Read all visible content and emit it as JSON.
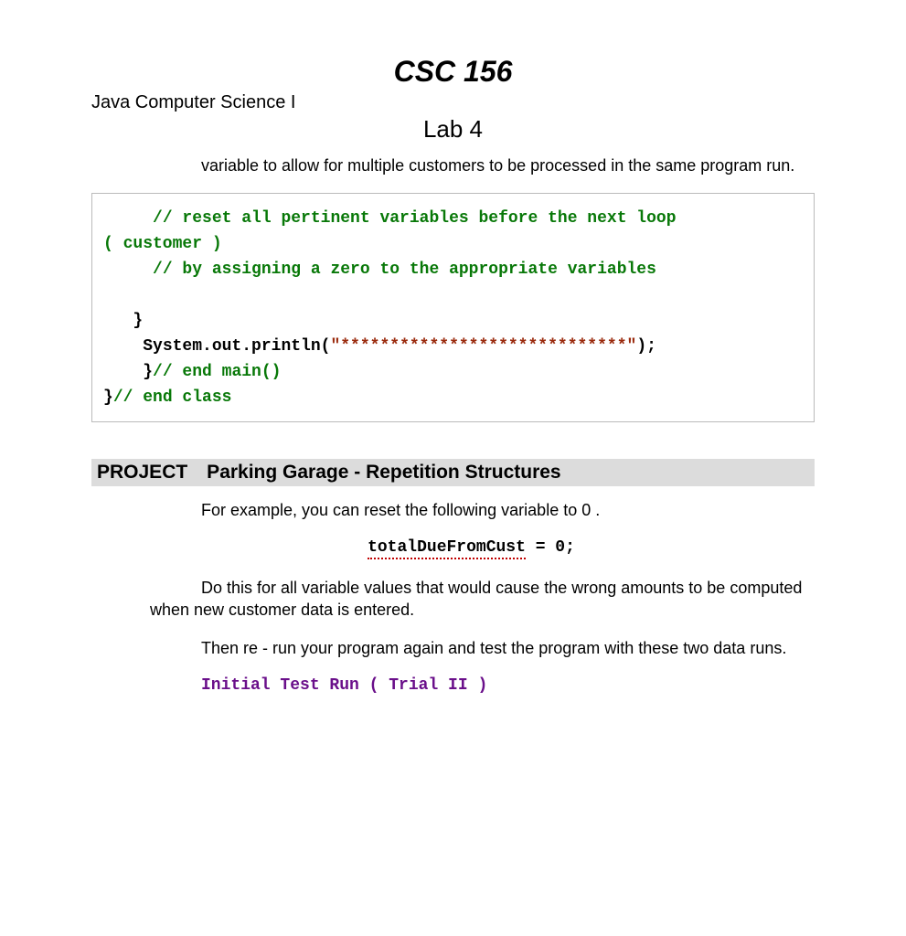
{
  "header": {
    "course_code": "CSC 156",
    "course_name": "Java Computer Science I",
    "lab_title": "Lab 4"
  },
  "body": {
    "para1": "variable to allow for multiple customers to be processed in the same program run.",
    "code": {
      "line1_indent": "     ",
      "line1_comment": "// reset all pertinent variables before the next loop",
      "line2": "( customer )",
      "line3_indent": "     ",
      "line3_comment": "// by assigning a zero to the appropriate variables",
      "line_blank": "",
      "line4": "   }",
      "line5_indent": "    ",
      "line5_call_a": "System.out.println(",
      "line5_str": "\"*****************************\"",
      "line5_call_b": ");",
      "line6_indent": "    ",
      "line6_brace": "}",
      "line6_comment": "// end main()",
      "line7_brace": "}",
      "line7_comment": "// end class"
    },
    "section_header": "PROJECT Parking Garage - Repetition Structures",
    "para2": "For example, you can reset the following variable to 0 .",
    "inline_code_underlined": "totalDueFromCust",
    "inline_code_rest": " = 0;",
    "para3": "Do this for all variable values that would cause the wrong amounts to be computed when new customer data is entered.",
    "para4": "Then re - run your program again and test the program with these two data runs.",
    "test_run_title": "Initial Test Run ( Trial II )"
  }
}
